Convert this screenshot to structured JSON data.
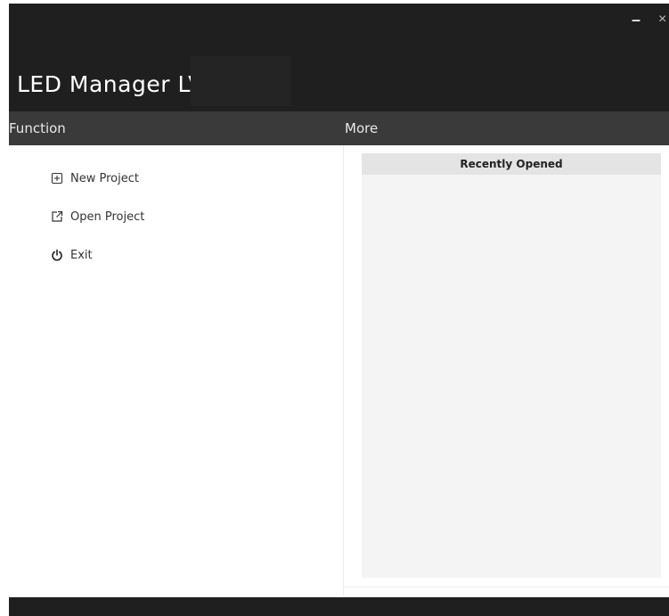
{
  "window": {
    "title": "LED Manager LV",
    "minimize_glyph": "–",
    "close_glyph": "×"
  },
  "sections": {
    "function_label": "Function",
    "more_label": "More"
  },
  "menu": {
    "items": [
      {
        "label": "New Project",
        "icon": "plus-box-icon"
      },
      {
        "label": "Open Project",
        "icon": "external-link-icon"
      },
      {
        "label": "Exit",
        "icon": "power-icon"
      }
    ]
  },
  "recent": {
    "header": "Recently Opened",
    "items": []
  },
  "colors": {
    "titlebar": "#1f1f1f",
    "section_bar": "#3a3a3a",
    "panel_bg": "#f4f4f4",
    "panel_header": "#e4e4e4"
  }
}
